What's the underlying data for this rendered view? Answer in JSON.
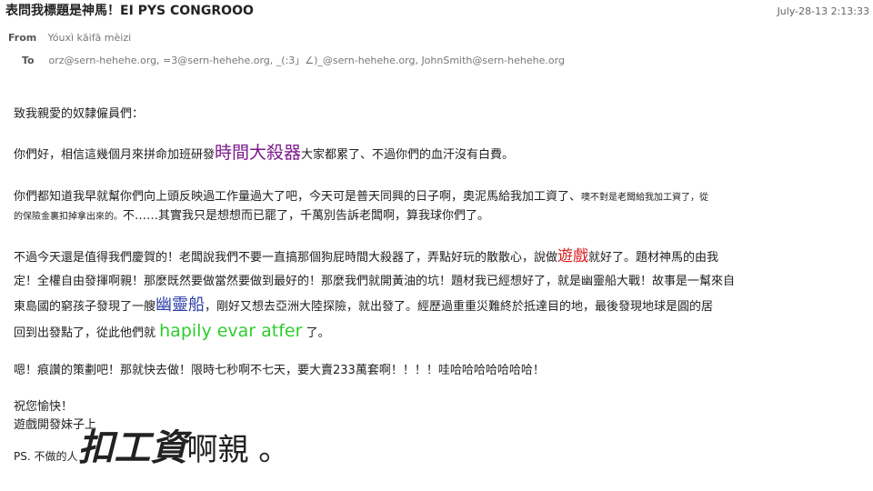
{
  "email": {
    "subject": "表問我標題是神馬！EI PYS CONGROOO",
    "date": "July-28-13 2:13:33",
    "from_label": "From",
    "from_value": "Yóuxì kāifā mèizi",
    "to_label": "To",
    "to_value": "orz@sern-hehehe.org, =3@sern-hehehe.org, _(:3」∠)_@sern-hehehe.org, JohnSmith@sern-hehehe.org"
  },
  "body": {
    "greeting": "致我親愛的奴隸僱員們：",
    "p2_a": "你們好，相信這幾個月來拼命加班研發",
    "p2_highlight": "時間大殺器",
    "p2_b": "大家都累了、不過你們的血汗沒有白費。",
    "p3_a": "你們都知道我早就幫你們向上頭反映過工作量過大了吧，今天可是普天同興的日子啊，奧泥馬給我加工資了、",
    "p3_small1": "噢不對是老闆給我加工資了，從",
    "p3_small2": "的保險金裏扣掉拿出來的。",
    "p3_b": "不……其實我只是想想而已罷了，千萬別告訴老闆啊，算我球你們了。",
    "p4_l1_a": "不過今天還是值得我們慶賀的！老闆說我們不要一直搞那個狗屁時間大殺器了，弄點好玩的散散心，說做",
    "p4_l1_highlight": "遊戲",
    "p4_l1_b": "就好了。題材神馬的由我",
    "p4_l2": "定！全權自由發揮啊親！那麼既然要做當然要做到最好的！那麼我們就開黃油的坑！題材我已經想好了，就是幽靈船大戰！故事是一幫來自",
    "p4_l3_a": "東島國的窮孩子發現了一艘",
    "p4_l3_highlight": "幽靈船",
    "p4_l3_b": "，剛好又想去亞洲大陸探險，就出發了。經歷過重重災難終於抵達目的地，最後發現地球是圓的居",
    "p4_l4_a": "回到出發點了，從此他們就 ",
    "p4_l4_highlight": "hapily evar atfer",
    "p4_l4_b": " 了。",
    "p5": "嗯！痕讚的策劃吧！那就快去做！限時七秒啊不七天，要大賣233萬套啊！！！！哇哈哈哈哈哈哈哈！",
    "closing1": "祝您愉快！",
    "closing2": "遊戲開發妹子上",
    "ps_small": "PS. 不做的人",
    "ps_huge": "扣工資",
    "ps_big": "啊親 。"
  }
}
